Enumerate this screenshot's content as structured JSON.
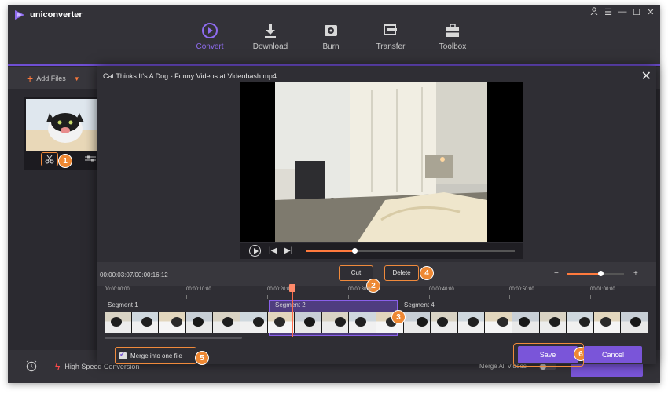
{
  "app": {
    "name": "uniconverter"
  },
  "window_controls": [
    "user-icon",
    "menu-icon",
    "minimize-icon",
    "maximize-icon",
    "close-icon"
  ],
  "nav": {
    "tabs": [
      {
        "label": "Convert",
        "icon": "convert-icon",
        "active": true
      },
      {
        "label": "Download",
        "icon": "download-icon",
        "active": false
      },
      {
        "label": "Burn",
        "icon": "burn-icon",
        "active": false
      },
      {
        "label": "Transfer",
        "icon": "transfer-icon",
        "active": false
      },
      {
        "label": "Toolbox",
        "icon": "toolbox-icon",
        "active": false
      }
    ]
  },
  "toolbar": {
    "add_files": "Add Files"
  },
  "bottom": {
    "high_speed": "High Speed Conversion",
    "merge_all": "Merge All Videos"
  },
  "dialog": {
    "title": "Cat Thinks It's A Dog - Funny Videos at Videobash.mp4",
    "timecode": "00:00:03:07/00:00:16:12",
    "cut_label": "Cut",
    "delete_label": "Delete",
    "ruler": [
      "00:00:00:00",
      "00:00:10:00",
      "00:00:20:00",
      "00:00:30:00",
      "00:00:40:00",
      "00:00:50:00",
      "00:01:00:00"
    ],
    "segments": [
      "Segment 1",
      "Segment 2",
      "Segment 4"
    ],
    "merge_label": "Merge into one file",
    "merge_checked": true,
    "save_label": "Save",
    "cancel_label": "Cancel",
    "playback_progress": 0.23,
    "zoom_level": 0.58
  },
  "callouts": [
    "1",
    "2",
    "3",
    "4",
    "5",
    "6"
  ],
  "colors": {
    "accent": "#7a55d9",
    "highlight": "#f08a3c",
    "background": "#2b2a30"
  }
}
